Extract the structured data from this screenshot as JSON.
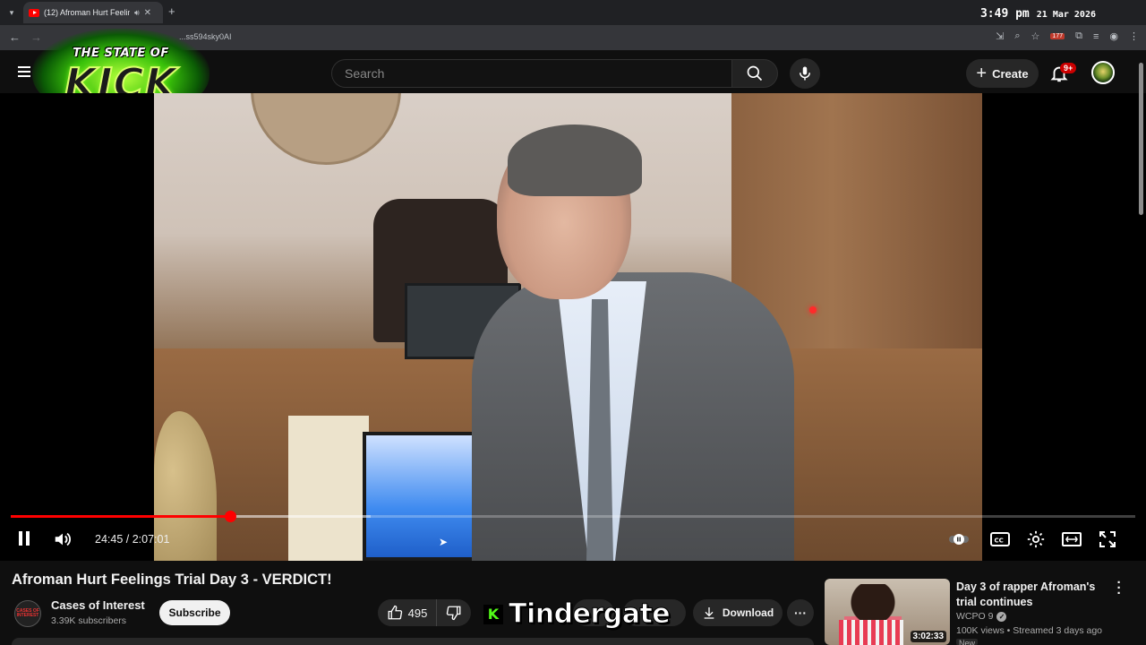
{
  "browser": {
    "tab_title": "(12) Afroman Hurt Feelings",
    "url": "...ss594sky0AI",
    "extension_badge": "177",
    "clock_time": "3:49 pm",
    "clock_date": "21 Mar 2026"
  },
  "overlay": {
    "logo_top": "THE STATE OF",
    "logo_main": "KICK",
    "tindergate_letter": "K",
    "tindergate_text": "Tindergate"
  },
  "youtube": {
    "search_placeholder": "Search",
    "create_label": "Create",
    "notifications_badge": "9+"
  },
  "player": {
    "time_display": "24:45 / 2:07:01",
    "progress_played_fraction": 0.1948,
    "progress_buffered_fraction": 0.32,
    "colors": {
      "played": "#ff0000",
      "accent": "#ff0000"
    }
  },
  "video": {
    "title": "Afroman Hurt Feelings Trial Day 3 - VERDICT!",
    "channel_name": "Cases of Interest",
    "channel_avatar_text": "CASES OF INTEREST",
    "subscribers": "3.39K subscribers",
    "subscribe_label": "Subscribe",
    "likes": "495",
    "download_label": "Download"
  },
  "recommendation": {
    "title": "Day 3 of rapper Afroman's trial continues",
    "channel": "WCPO 9",
    "meta": "100K views • Streamed 3 days ago",
    "duration": "3:02:33",
    "badge": "New"
  }
}
